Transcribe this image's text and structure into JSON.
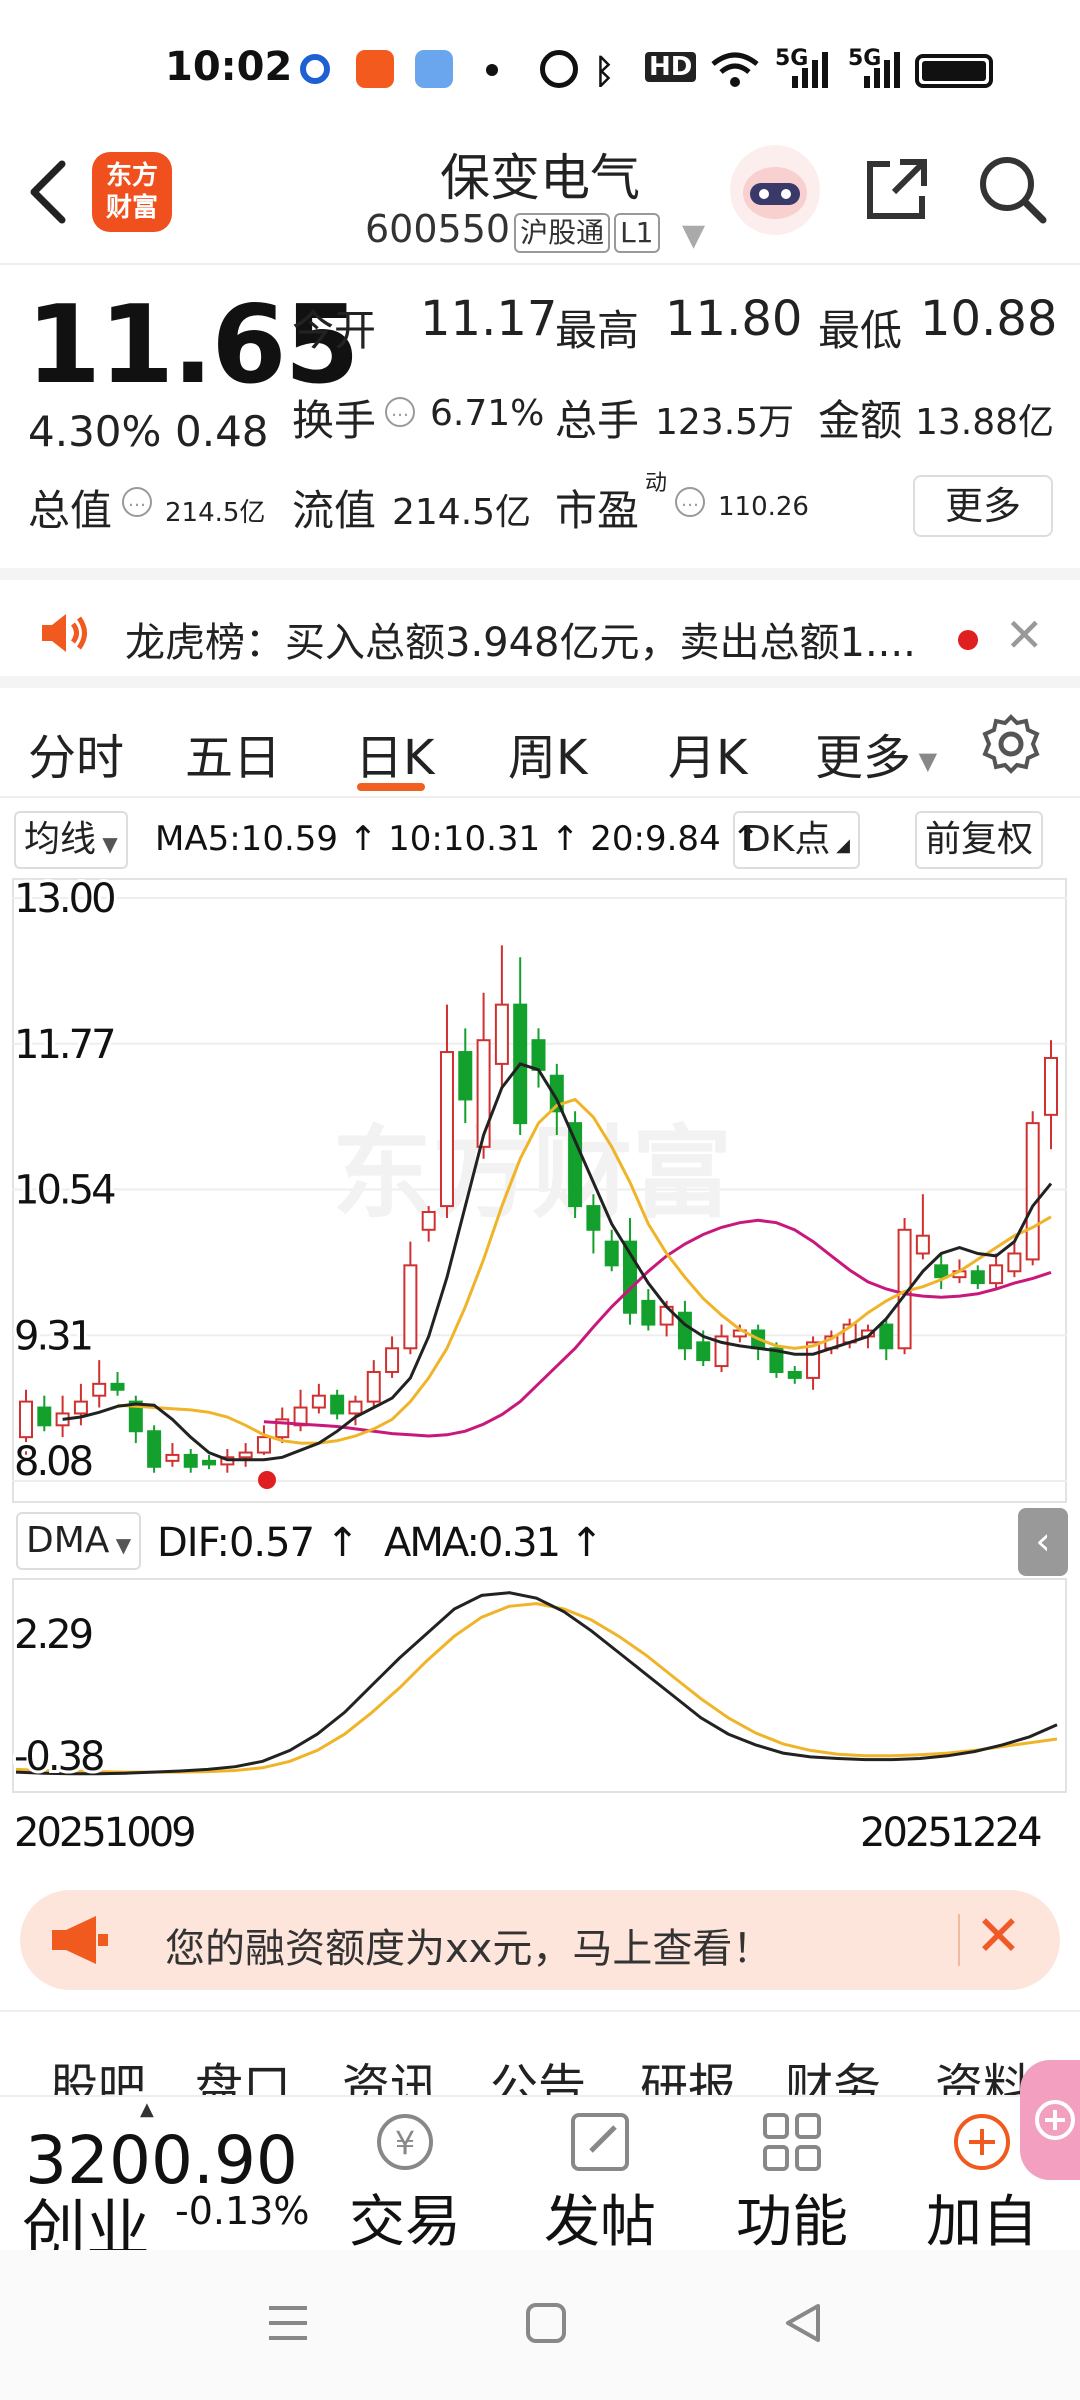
{
  "status_bar": {
    "time": "10:02",
    "hd_label": "HD",
    "signal1_label": "5G",
    "signal2_label": "5G"
  },
  "header": {
    "logo_text_line1": "东方",
    "logo_text_line2": "财富",
    "stock_name": "保变电气",
    "stock_code": "600550",
    "chip_hgt": "沪股通",
    "chip_level": "L1"
  },
  "quote": {
    "price": "11.65",
    "change_pct": "4.30%",
    "change_amt": "0.48",
    "open_label": "今开",
    "open_value": "11.17",
    "high_label": "最高",
    "high_value": "11.80",
    "low_label": "最低",
    "low_value": "10.88",
    "turnover_label": "换手",
    "turnover_value": "6.71%",
    "volume_label": "总手",
    "volume_value": "123.5万",
    "amount_label": "金额",
    "amount_value": "13.88亿",
    "mktcap_label": "总值",
    "mktcap_value": "214.5亿",
    "float_label": "流值",
    "float_value": "214.5亿",
    "pe_label": "市盈",
    "pe_super": "动",
    "pe_value": "110.26",
    "more_label": "更多"
  },
  "news": {
    "text": "龙虎榜：买入总额3.948亿元，卖出总额1...."
  },
  "kline_tabs": [
    "分时",
    "五日",
    "日K",
    "周K",
    "月K",
    "更多"
  ],
  "indicators": {
    "ma_button": "均线",
    "ma_text": "MA5:10.59 ↑ 10:10.31 ↑ 20:9.84 ↑",
    "dk_button": "DK点",
    "adjust_button": "前复权"
  },
  "chart_data": {
    "type": "candlestick",
    "y_ticks": [
      "13.00",
      "11.77",
      "10.54",
      "9.31",
      "8.08"
    ],
    "ylim": [
      8.08,
      13.0
    ],
    "x_start": "20251009",
    "x_end": "20251224",
    "watermark": "东方财富",
    "colors": {
      "up": "#d03030",
      "down": "#13a02c",
      "ma5": "#222222",
      "ma10": "#f0b429",
      "ma20": "#c8187c"
    },
    "candles": [
      [
        8.45,
        8.75,
        8.3,
        8.85
      ],
      [
        8.7,
        8.55,
        8.5,
        8.8
      ],
      [
        8.55,
        8.65,
        8.45,
        8.8
      ],
      [
        8.65,
        8.75,
        8.55,
        8.9
      ],
      [
        8.8,
        8.9,
        8.7,
        9.1
      ],
      [
        8.9,
        8.85,
        8.8,
        9.0
      ],
      [
        8.75,
        8.5,
        8.4,
        8.8
      ],
      [
        8.5,
        8.2,
        8.15,
        8.55
      ],
      [
        8.25,
        8.3,
        8.2,
        8.4
      ],
      [
        8.3,
        8.2,
        8.15,
        8.35
      ],
      [
        8.25,
        8.22,
        8.18,
        8.3
      ],
      [
        8.22,
        8.28,
        8.15,
        8.35
      ],
      [
        8.28,
        8.32,
        8.2,
        8.4
      ],
      [
        8.32,
        8.45,
        8.3,
        8.55
      ],
      [
        8.45,
        8.6,
        8.4,
        8.7
      ],
      [
        8.55,
        8.7,
        8.5,
        8.85
      ],
      [
        8.7,
        8.8,
        8.65,
        8.9
      ],
      [
        8.8,
        8.65,
        8.6,
        8.85
      ],
      [
        8.65,
        8.75,
        8.55,
        8.8
      ],
      [
        8.75,
        9.0,
        8.7,
        9.1
      ],
      [
        9.0,
        9.2,
        8.95,
        9.3
      ],
      [
        9.2,
        9.9,
        9.15,
        10.1
      ],
      [
        10.2,
        10.35,
        10.1,
        10.4
      ],
      [
        10.4,
        11.7,
        10.3,
        12.1
      ],
      [
        11.7,
        11.3,
        11.1,
        11.9
      ],
      [
        10.9,
        11.8,
        10.8,
        12.2
      ],
      [
        11.6,
        12.1,
        11.4,
        12.6
      ],
      [
        12.1,
        11.1,
        11.0,
        12.5
      ],
      [
        11.8,
        11.55,
        11.4,
        11.9
      ],
      [
        11.5,
        11.2,
        11.0,
        11.6
      ],
      [
        11.1,
        10.4,
        10.3,
        11.2
      ],
      [
        10.4,
        10.2,
        10.0,
        10.5
      ],
      [
        10.1,
        9.9,
        9.85,
        10.2
      ],
      [
        10.1,
        9.5,
        9.4,
        10.3
      ],
      [
        9.6,
        9.4,
        9.35,
        9.7
      ],
      [
        9.4,
        9.55,
        9.3,
        9.6
      ],
      [
        9.5,
        9.2,
        9.1,
        9.6
      ],
      [
        9.25,
        9.1,
        9.05,
        9.35
      ],
      [
        9.05,
        9.3,
        9.0,
        9.4
      ],
      [
        9.3,
        9.35,
        9.25,
        9.4
      ],
      [
        9.35,
        9.2,
        9.1,
        9.4
      ],
      [
        9.2,
        9.0,
        8.95,
        9.25
      ],
      [
        9.0,
        8.95,
        8.9,
        9.05
      ],
      [
        8.95,
        9.25,
        8.85,
        9.3
      ],
      [
        9.2,
        9.3,
        9.15,
        9.35
      ],
      [
        9.25,
        9.4,
        9.2,
        9.45
      ],
      [
        9.3,
        9.35,
        9.2,
        9.4
      ],
      [
        9.4,
        9.2,
        9.1,
        9.45
      ],
      [
        9.2,
        10.2,
        9.15,
        10.3
      ],
      [
        10.0,
        10.15,
        9.95,
        10.5
      ],
      [
        9.9,
        9.8,
        9.7,
        10.0
      ],
      [
        9.8,
        9.85,
        9.75,
        9.95
      ],
      [
        9.85,
        9.75,
        9.7,
        9.9
      ],
      [
        9.75,
        9.9,
        9.7,
        10.0
      ],
      [
        9.85,
        10.0,
        9.8,
        10.1
      ],
      [
        9.95,
        11.1,
        9.9,
        11.2
      ],
      [
        11.17,
        11.65,
        10.88,
        11.8
      ]
    ],
    "ma5": [
      8.6,
      8.62,
      8.66,
      8.71,
      8.73,
      8.72,
      8.6,
      8.45,
      8.32,
      8.26,
      8.26,
      8.26,
      8.28,
      8.34,
      8.4,
      8.5,
      8.62,
      8.7,
      8.78,
      8.95,
      9.3,
      9.8,
      10.4,
      11.0,
      11.4,
      11.6,
      11.55,
      11.3,
      10.95,
      10.6,
      10.25,
      10.0,
      9.75,
      9.55,
      9.4,
      9.3,
      9.25,
      9.22,
      9.2,
      9.18,
      9.15,
      9.15,
      9.2,
      9.25,
      9.3,
      9.45,
      9.65,
      9.85,
      10.0,
      10.05,
      10.0,
      9.98,
      10.1,
      10.4,
      10.59
    ],
    "ma10": [
      8.72,
      8.71,
      8.7,
      8.69,
      8.68,
      8.66,
      8.62,
      8.55,
      8.47,
      8.42,
      8.4,
      8.4,
      8.42,
      8.46,
      8.52,
      8.6,
      8.75,
      8.95,
      9.2,
      9.55,
      9.95,
      10.4,
      10.8,
      11.1,
      11.25,
      11.3,
      11.15,
      10.9,
      10.6,
      10.25,
      10.0,
      9.8,
      9.62,
      9.48,
      9.36,
      9.28,
      9.22,
      9.2,
      9.22,
      9.28,
      9.38,
      9.5,
      9.6,
      9.68,
      9.72,
      9.78,
      9.85,
      9.95,
      10.05,
      10.15,
      10.22,
      10.31
    ],
    "ma20": [
      8.58,
      8.57,
      8.56,
      8.55,
      8.54,
      8.52,
      8.5,
      8.48,
      8.47,
      8.46,
      8.47,
      8.5,
      8.56,
      8.64,
      8.75,
      8.9,
      9.05,
      9.2,
      9.38,
      9.55,
      9.7,
      9.85,
      9.98,
      10.08,
      10.16,
      10.22,
      10.26,
      10.28,
      10.26,
      10.2,
      10.1,
      9.98,
      9.86,
      9.76,
      9.7,
      9.66,
      9.64,
      9.63,
      9.64,
      9.66,
      9.7,
      9.75,
      9.79,
      9.84
    ],
    "dma": {
      "label": "DMA",
      "dif_text": "DIF:0.57 ↑",
      "ama_text": "AMA:0.31 ↑",
      "y_ticks": [
        "2.29",
        "-0.38"
      ],
      "ylim": [
        -0.38,
        2.29
      ],
      "dif": [
        -0.3,
        -0.32,
        -0.33,
        -0.33,
        -0.32,
        -0.3,
        -0.28,
        -0.25,
        -0.2,
        -0.1,
        0.1,
        0.4,
        0.8,
        1.3,
        1.8,
        2.25,
        2.7,
        2.95,
        3.0,
        2.9,
        2.65,
        2.3,
        1.9,
        1.5,
        1.1,
        0.7,
        0.4,
        0.2,
        0.05,
        -0.02,
        -0.05,
        -0.07,
        -0.07,
        -0.05,
        0.0,
        0.08,
        0.2,
        0.35,
        0.57
      ],
      "ama": [
        -0.25,
        -0.27,
        -0.28,
        -0.29,
        -0.3,
        -0.3,
        -0.3,
        -0.29,
        -0.27,
        -0.22,
        -0.1,
        0.1,
        0.4,
        0.8,
        1.25,
        1.75,
        2.2,
        2.55,
        2.75,
        2.8,
        2.7,
        2.5,
        2.2,
        1.85,
        1.45,
        1.05,
        0.7,
        0.42,
        0.22,
        0.1,
        0.03,
        0.0,
        0.0,
        0.02,
        0.05,
        0.1,
        0.17,
        0.24,
        0.31
      ]
    }
  },
  "promo": {
    "text": "您的融资额度为xx元，马上查看！"
  },
  "info_tabs": [
    "股吧",
    "盘口",
    "资讯",
    "公告",
    "研报",
    "财务",
    "资料"
  ],
  "bottom_bar": {
    "index_value": "3200.90",
    "index_name": "创业",
    "index_change": "-0.13%",
    "items": [
      "交易",
      "发帖",
      "功能",
      "加自"
    ]
  }
}
